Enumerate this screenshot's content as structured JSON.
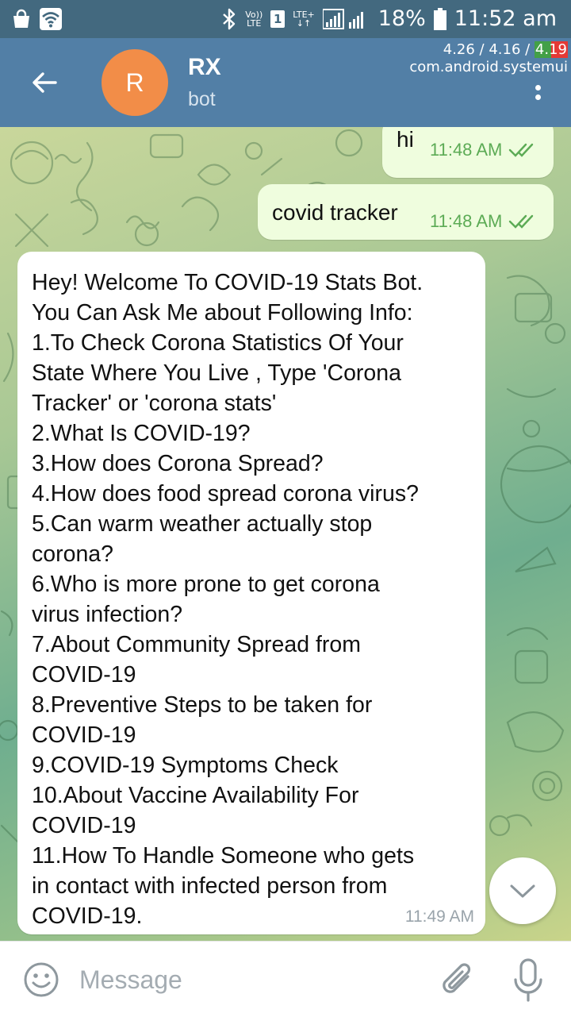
{
  "status_bar": {
    "volte_top": "Vo))",
    "volte_bottom": "LTE",
    "sim_slot": "1",
    "lte_top": "LTE+",
    "lte_bottom": "↓↑",
    "battery": "18%",
    "time": "11:52 am"
  },
  "overlay": {
    "load_avg_prefix": "4.26 / 4.16 / ",
    "load_avg_last": "4.19",
    "process": "com.android.systemui"
  },
  "app_bar": {
    "avatar_letter": "R",
    "title": "RX",
    "subtitle": "bot"
  },
  "messages": {
    "out_1": {
      "text": "hi",
      "time": "11:48 AM"
    },
    "out_2": {
      "text": "covid tracker",
      "time": "11:48 AM"
    },
    "in_1": {
      "text": "Hey! Welcome To COVID-19 Stats Bot.\nYou Can Ask Me about Following Info:\n1.To Check Corona Statistics Of Your\nState Where You Live , Type 'Corona\nTracker' or 'corona stats'\n2.What Is COVID-19?\n3.How does Corona Spread?\n4.How does food spread corona virus?\n5.Can warm weather actually stop\ncorona?\n6.Who is more prone to get corona\nvirus infection?\n7.About Community Spread from\nCOVID-19\n8.Preventive Steps to be taken for\nCOVID-19\n9.COVID-19 Symptoms Check\n10.About Vaccine Availability For\nCOVID-19\n11.How To Handle Someone who gets\nin contact with infected person from\nCOVID-19.",
      "time": "11:49 AM"
    }
  },
  "input_bar": {
    "placeholder": "Message"
  },
  "colors": {
    "status_bar": "#43697f",
    "app_bar": "#527fa6",
    "avatar": "#f28d48",
    "outgoing_bubble": "#effdde",
    "read_ticks": "#5cab55"
  },
  "icons": {
    "status_left": [
      "shopping-bag-icon",
      "wifi-icon"
    ],
    "status_right": [
      "bluetooth-icon",
      "signal-icon",
      "battery-icon"
    ],
    "app_bar": [
      "back-arrow-icon",
      "more-vert-icon"
    ],
    "input": [
      "emoji-icon",
      "paperclip-icon",
      "microphone-icon"
    ],
    "chat": [
      "double-check-icon",
      "chevron-down-icon"
    ]
  }
}
